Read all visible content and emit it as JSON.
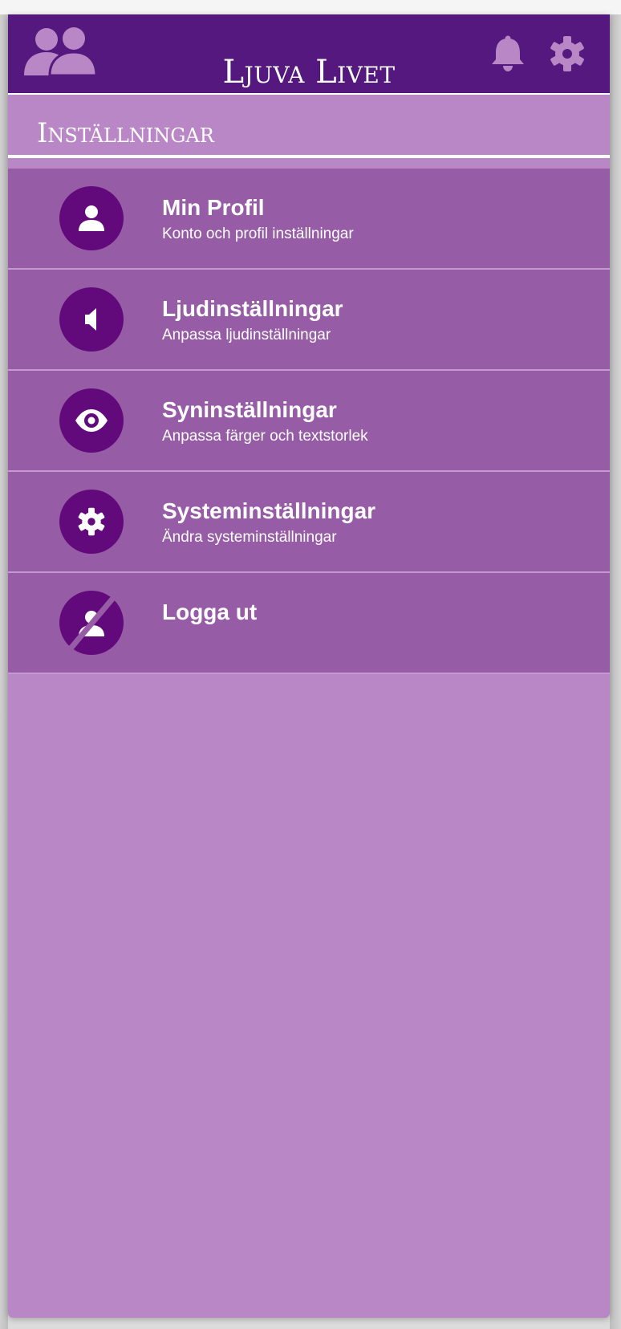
{
  "colors": {
    "header_bg": "#54187e",
    "page_bg": "#b987c6",
    "item_bg": "#975ca6",
    "icon_circle": "#62097c",
    "header_icon": "#b987c6",
    "text": "#ffffff"
  },
  "header": {
    "title": "Ljuva Livet",
    "left_icon": "users-icon",
    "right_icons": [
      "bell-icon",
      "gear-icon"
    ]
  },
  "section": {
    "title": "Inställningar"
  },
  "menu": {
    "items": [
      {
        "icon": "user-icon",
        "title": "Min Profil",
        "subtitle": "Konto och profil inställningar"
      },
      {
        "icon": "speaker-icon",
        "title": "Ljudinställningar",
        "subtitle": "Anpassa ljudinställningar"
      },
      {
        "icon": "eye-icon",
        "title": "Syninställningar",
        "subtitle": "Anpassa färger och textstorlek"
      },
      {
        "icon": "gear-icon",
        "title": "Systeminställningar",
        "subtitle": "Ändra systeminställningar"
      },
      {
        "icon": "user-slash-icon",
        "title": "Logga ut",
        "subtitle": ""
      }
    ]
  }
}
